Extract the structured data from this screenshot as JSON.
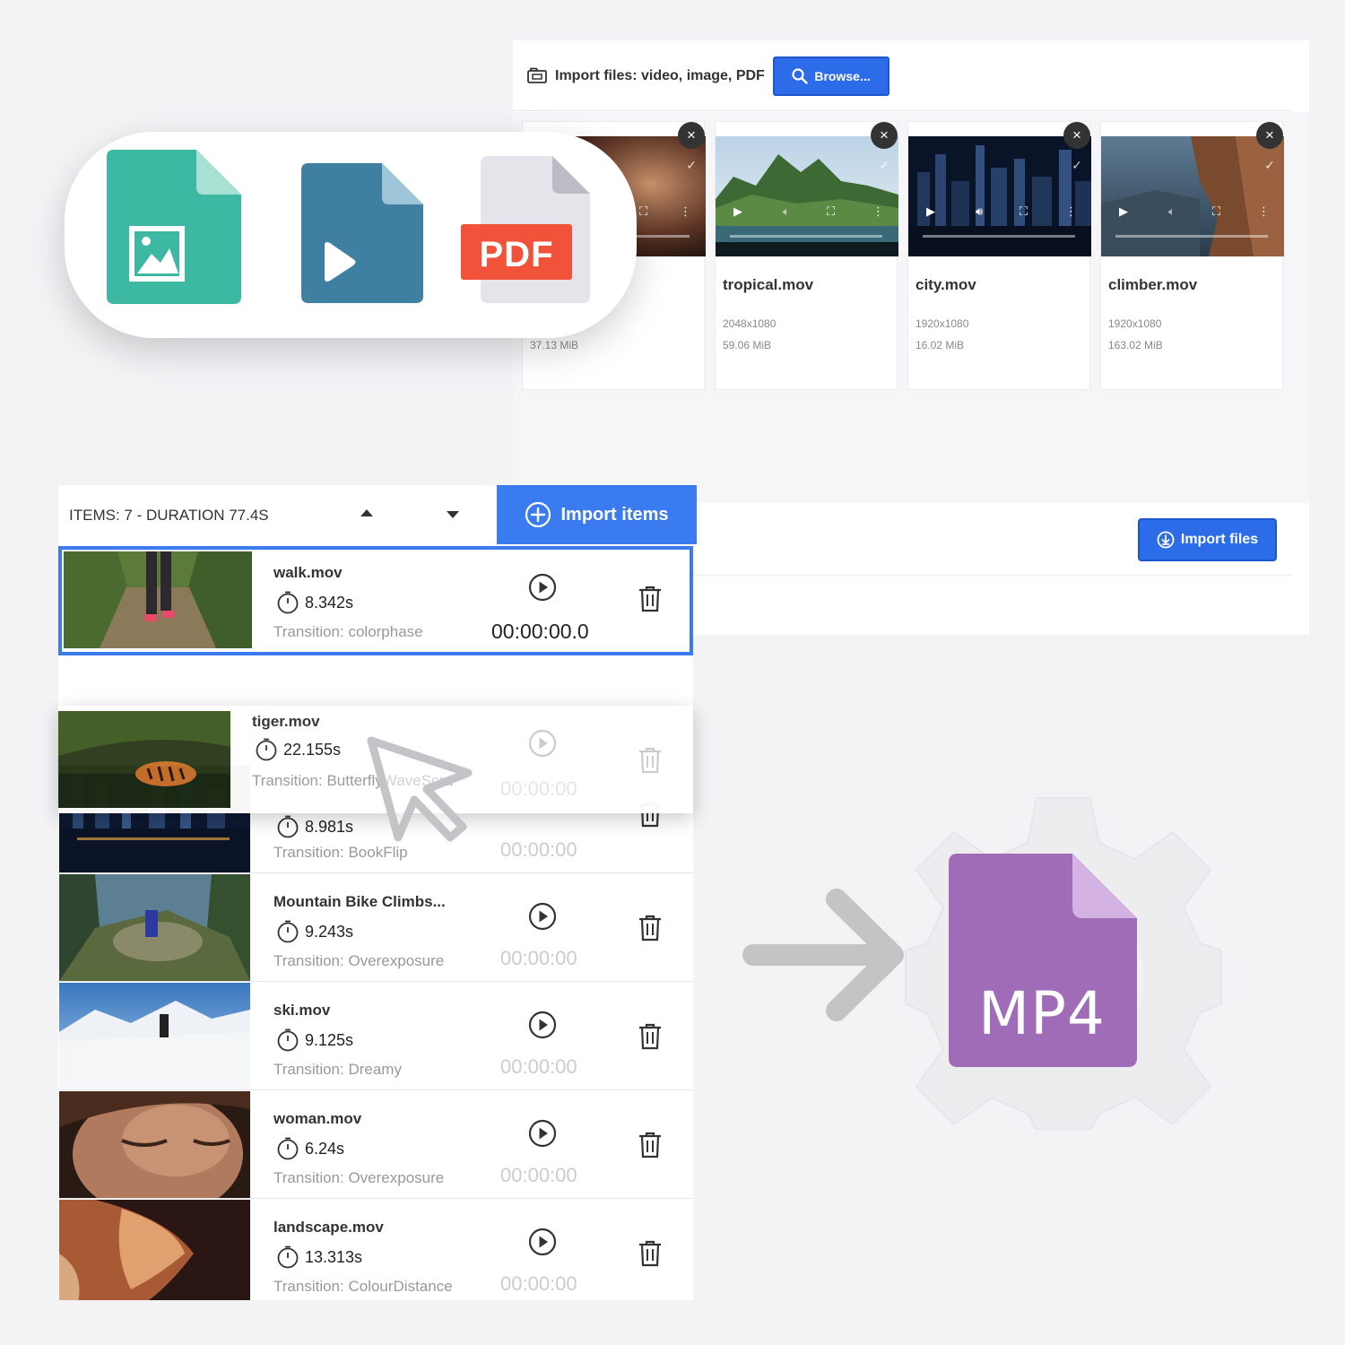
{
  "import_panel": {
    "title": "Import files: video, image, PDF",
    "browse_label": "Browse...",
    "import_files_label": "Import files",
    "files": [
      {
        "name": "",
        "resolution": "",
        "size": "37.13 MiB"
      },
      {
        "name": "tropical.mov",
        "resolution": "2048x1080",
        "size": "59.06 MiB"
      },
      {
        "name": "city.mov",
        "resolution": "1920x1080",
        "size": "16.02 MiB"
      },
      {
        "name": "climber.mov",
        "resolution": "1920x1080",
        "size": "163.02 MiB"
      }
    ],
    "remove_glyph": "×",
    "check_glyph": "✓"
  },
  "file_types": {
    "image_color": "#3cb8a3",
    "video_color": "#3e7fa2",
    "pdf_label": "PDF",
    "pdf_color": "#f0533a"
  },
  "timeline": {
    "summary": "ITEMS: 7 - DURATION 77.4S",
    "import_items_label": "Import items",
    "selected": {
      "name": "walk.mov",
      "duration": "8.342s",
      "transition": "Transition: colorphase",
      "time": "00:00:00.0"
    },
    "dragging": {
      "name": "tiger.mov",
      "duration": "22.155s",
      "transition": "Transition: ButterflyWaveScra",
      "time": "00:00:00"
    },
    "items": [
      {
        "name": "",
        "duration": "8.981s",
        "transition": "Transition: BookFlip",
        "time": "00:00:00"
      },
      {
        "name": "Mountain Bike Climbs...",
        "duration": "9.243s",
        "transition": "Transition: Overexposure",
        "time": "00:00:00"
      },
      {
        "name": "ski.mov",
        "duration": "9.125s",
        "transition": "Transition: Dreamy",
        "time": "00:00:00"
      },
      {
        "name": "woman.mov",
        "duration": "6.24s",
        "transition": "Transition: Overexposure",
        "time": "00:00:00"
      },
      {
        "name": "landscape.mov",
        "duration": "13.313s",
        "transition": "Transition: ColourDistance",
        "time": "00:00:00"
      }
    ]
  },
  "output": {
    "format_label": "MP4",
    "file_color": "#a06cb8",
    "accent": "#3a7cf0"
  }
}
